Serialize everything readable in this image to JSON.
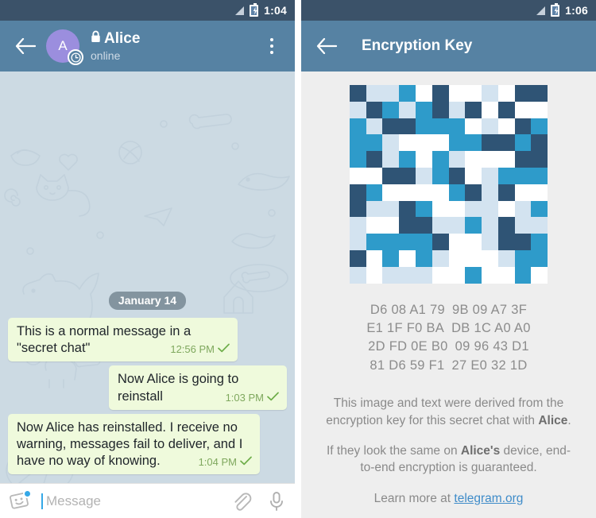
{
  "left": {
    "statusbar": {
      "time": "1:04",
      "signal_icon": "signal-triangle-icon",
      "battery_icon": "battery-charging-icon"
    },
    "appbar": {
      "back_icon": "back-arrow-icon",
      "avatar_initial": "A",
      "avatar_timer_icon": "self-destruct-timer-icon",
      "lock_icon": "lock-icon",
      "chat_name": "Alice",
      "chat_status": "online",
      "menu_icon": "overflow-menu-icon"
    },
    "chat": {
      "date_separator": "January 14",
      "messages": [
        {
          "text": "This is a normal message in a \"secret chat\"",
          "time": "12:56 PM",
          "align": "left",
          "status_icon": "single-check-icon"
        },
        {
          "text": "Now Alice is going to reinstall",
          "time": "1:03 PM",
          "align": "right",
          "status_icon": "single-check-icon"
        },
        {
          "text": "Now Alice has reinstalled. I receive no warning, messages fail to deliver, and I have no way of knowing.",
          "time": "1:04 PM",
          "align": "left",
          "status_icon": "single-check-icon"
        }
      ]
    },
    "composer": {
      "emoji_icon": "sticker-smiley-icon",
      "placeholder": "Message",
      "value": "",
      "attach_icon": "paperclip-icon",
      "mic_icon": "microphone-icon"
    }
  },
  "right": {
    "statusbar": {
      "time": "1:06",
      "signal_icon": "signal-triangle-icon",
      "battery_icon": "battery-charging-icon"
    },
    "appbar": {
      "back_icon": "back-arrow-icon",
      "title": "Encryption Key"
    },
    "identicon": {
      "name": "encryption-key-identicon",
      "cols": 12,
      "rows": 12,
      "palette": {
        "dark": "#2f5475",
        "mid": "#2e9bca",
        "light": "#d3e3f0",
        "white": "#ffffff"
      },
      "grid": [
        [
          "dark",
          "light",
          "light",
          "mid",
          "white",
          "dark",
          "white",
          "white",
          "light",
          "white",
          "dark",
          "dark"
        ],
        [
          "light",
          "dark",
          "mid",
          "light",
          "mid",
          "dark",
          "light",
          "dark",
          "white",
          "dark",
          "white",
          "white"
        ],
        [
          "mid",
          "light",
          "dark",
          "dark",
          "mid",
          "mid",
          "mid",
          "white",
          "light",
          "white",
          "dark",
          "mid"
        ],
        [
          "mid",
          "mid",
          "light",
          "white",
          "white",
          "white",
          "mid",
          "mid",
          "dark",
          "dark",
          "mid",
          "dark"
        ],
        [
          "mid",
          "dark",
          "light",
          "mid",
          "white",
          "mid",
          "light",
          "white",
          "white",
          "white",
          "dark",
          "dark"
        ],
        [
          "white",
          "white",
          "dark",
          "dark",
          "light",
          "mid",
          "dark",
          "white",
          "light",
          "mid",
          "mid",
          "mid"
        ],
        [
          "dark",
          "mid",
          "white",
          "white",
          "white",
          "white",
          "mid",
          "dark",
          "light",
          "dark",
          "white",
          "white"
        ],
        [
          "dark",
          "light",
          "light",
          "dark",
          "mid",
          "white",
          "white",
          "light",
          "light",
          "white",
          "light",
          "mid"
        ],
        [
          "light",
          "white",
          "white",
          "dark",
          "dark",
          "light",
          "light",
          "mid",
          "light",
          "dark",
          "light",
          "light"
        ],
        [
          "light",
          "mid",
          "mid",
          "mid",
          "mid",
          "dark",
          "white",
          "white",
          "light",
          "dark",
          "dark",
          "mid"
        ],
        [
          "dark",
          "white",
          "mid",
          "white",
          "mid",
          "light",
          "white",
          "white",
          "white",
          "light",
          "mid",
          "mid"
        ],
        [
          "light",
          "white",
          "light",
          "light",
          "light",
          "white",
          "white",
          "mid",
          "white",
          "white",
          "mid",
          "white"
        ]
      ]
    },
    "hex_key": {
      "name": "encryption-key-fingerprint",
      "rows": [
        {
          "left": "D6 08 A1 79",
          "right": "9B 09 A7 3F"
        },
        {
          "left": "E1 1F F0 BA",
          "right": "DB 1C A0 A0"
        },
        {
          "left": "2D FD 0E B0",
          "right": "09 96 43 D1"
        },
        {
          "left": "81 D6 59 F1",
          "right": "27 E0 32 1D"
        }
      ]
    },
    "description": {
      "p1_a": "This image and text were derived from the encryption key for this secret chat with ",
      "p1_bold": "Alice",
      "p1_b": ".",
      "p2_a": "If they look the same on ",
      "p2_bold": "Alice's",
      "p2_b": " device, end-to-end encryption is guaranteed."
    },
    "learn_more": {
      "prefix": "Learn more at ",
      "link_text": "telegram.org"
    }
  }
}
